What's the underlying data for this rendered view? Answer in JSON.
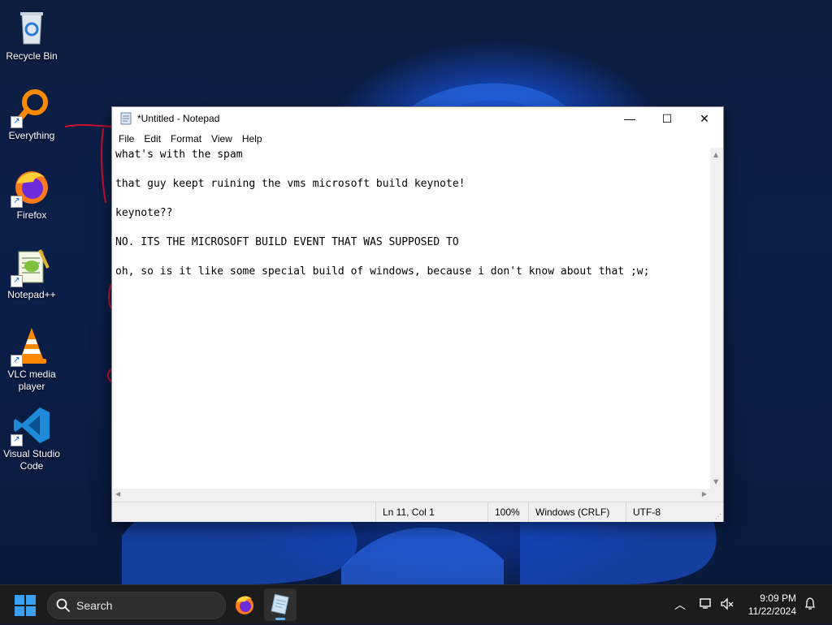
{
  "desktop": {
    "icons": [
      {
        "label": "Recycle Bin",
        "icon": "recycle-bin-icon",
        "shortcut": false
      },
      {
        "label": "Everything",
        "icon": "everything-search-icon",
        "shortcut": true
      },
      {
        "label": "Firefox",
        "icon": "firefox-icon",
        "shortcut": true
      },
      {
        "label": "Notepad++",
        "icon": "notepad-plus-plus-icon",
        "shortcut": true
      },
      {
        "label": "VLC media player",
        "icon": "vlc-cone-icon",
        "shortcut": true
      },
      {
        "label": "Visual Studio Code",
        "icon": "vscode-icon",
        "shortcut": true
      }
    ]
  },
  "window": {
    "title": "*Untitled - Notepad",
    "minimize": "—",
    "maximize": "☐",
    "close": "✕"
  },
  "menu": [
    "File",
    "Edit",
    "Format",
    "View",
    "Help"
  ],
  "editor": {
    "lines": [
      "what's with the spam",
      "",
      "that guy keept ruining the vms microsoft build keynote!",
      "",
      "keynote??",
      "",
      "NO. ITS THE MICROSOFT BUILD EVENT THAT WAS SUPPOSED TO",
      "",
      "oh, so is it like some special build of windows, because i don't know about that ;w;"
    ]
  },
  "status": {
    "position": "Ln 11, Col 1",
    "zoom": "100%",
    "line_ending": "Windows (CRLF)",
    "encoding": "UTF-8"
  },
  "taskbar": {
    "search_label": "Search",
    "time": "9:09 PM",
    "date": "11/22/2024",
    "apps": [
      "firefox-icon",
      "notepad-icon"
    ]
  },
  "colors": {
    "annotation_red": "#c8102e",
    "taskbar_bg": "#1c1c1c",
    "accent": "#5fb2f2"
  }
}
